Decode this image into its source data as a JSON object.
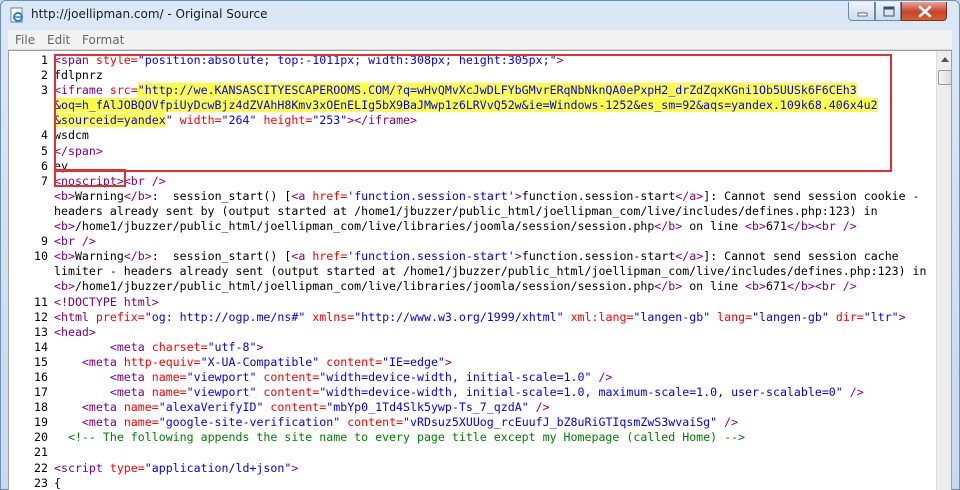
{
  "window": {
    "title": "http://joellipman.com/ - Original Source"
  },
  "menu": [
    "File",
    "Edit",
    "Format"
  ],
  "colors": {
    "tag": "#800080",
    "attr": "#ff0000",
    "value": "#0000ff",
    "comment": "#008000",
    "highlight": "#ffff44",
    "annotation": "#e03030"
  },
  "source": {
    "lines": [
      {
        "n": "1",
        "tokens": [
          [
            "tag",
            "<span "
          ],
          [
            "att",
            "style="
          ],
          [
            "val",
            "\"position:absolute; top:-1011px; width:308px; height:305px;\""
          ],
          [
            "tag",
            ">"
          ]
        ]
      },
      {
        "n": "2",
        "tokens": [
          [
            "plain",
            "fdlpnrz"
          ]
        ]
      },
      {
        "n": "3",
        "tokens": [
          [
            "tag",
            "<iframe "
          ],
          [
            "att",
            "src="
          ],
          [
            "valhl",
            "\"http://we.KANSASCITYESCAPEROOMS.COM/?q=wHvQMvXcJwDLFYbGMvrERqNbNknQA0ePxpH2_drZdZqxKGni1Ob5UUSk6F6CEh3"
          ]
        ]
      },
      {
        "n": "",
        "tokens": [
          [
            "valhl",
            "&oq=h_fAlJOBQOVfpiUyDcwBjz4dZVAhH8Kmv3xOEnELIg5bX9BaJMwp1z6LRVvQ52w&ie=Windows-1252&es_sm=92&aqs=yandex.109k68.406x4u2"
          ]
        ]
      },
      {
        "n": "",
        "tokens": [
          [
            "valhl",
            "&sourceid=yandex"
          ],
          [
            "val",
            "\" "
          ],
          [
            "att",
            "width="
          ],
          [
            "val",
            "\"264\" "
          ],
          [
            "att",
            "height="
          ],
          [
            "val",
            "\"253\""
          ],
          [
            "tag",
            "></iframe>"
          ]
        ]
      },
      {
        "n": "4",
        "tokens": [
          [
            "plain",
            "wsdcm"
          ]
        ]
      },
      {
        "n": "5",
        "tokens": [
          [
            "tag",
            "</span>"
          ]
        ]
      },
      {
        "n": "6",
        "tokens": [
          [
            "plain",
            "ey"
          ]
        ]
      },
      {
        "n": "7",
        "tokens": [
          [
            "tag",
            "<noscript>"
          ],
          [
            "tag",
            "<br />"
          ]
        ]
      },
      {
        "n": "",
        "tokens": [
          [
            "tag",
            "<b>"
          ],
          [
            "plain",
            "Warning"
          ],
          [
            "tag",
            "</b>"
          ],
          [
            "plain",
            ":  session_start() ["
          ],
          [
            "tag",
            "<a "
          ],
          [
            "att",
            "href="
          ],
          [
            "val",
            "'function.session-start'"
          ],
          [
            "tag",
            ">"
          ],
          [
            "plain",
            "function.session-start"
          ],
          [
            "tag",
            "</a>"
          ],
          [
            "plain",
            "]: Cannot send session cookie -"
          ]
        ]
      },
      {
        "n": "",
        "tokens": [
          [
            "plain",
            "headers already sent by (output started at /home1/jbuzzer/public_html/joellipman_com/live/includes/defines.php:123) in"
          ]
        ]
      },
      {
        "n": "",
        "tokens": [
          [
            "tag",
            "<b>"
          ],
          [
            "plain",
            "/home1/jbuzzer/public_html/joellipman_com/live/libraries/joomla/session/session.php"
          ],
          [
            "tag",
            "</b>"
          ],
          [
            "plain",
            " on line "
          ],
          [
            "tag",
            "<b>"
          ],
          [
            "plain",
            "671"
          ],
          [
            "tag",
            "</b><br />"
          ]
        ]
      },
      {
        "n": "9",
        "tokens": [
          [
            "tag",
            "<br />"
          ]
        ]
      },
      {
        "n": "10",
        "tokens": [
          [
            "tag",
            "<b>"
          ],
          [
            "plain",
            "Warning"
          ],
          [
            "tag",
            "</b>"
          ],
          [
            "plain",
            ":  session_start() ["
          ],
          [
            "tag",
            "<a "
          ],
          [
            "att",
            "href="
          ],
          [
            "val",
            "'function.session-start'"
          ],
          [
            "tag",
            ">"
          ],
          [
            "plain",
            "function.session-start"
          ],
          [
            "tag",
            "</a>"
          ],
          [
            "plain",
            "]: Cannot send session cache"
          ]
        ]
      },
      {
        "n": "",
        "tokens": [
          [
            "plain",
            "limiter - headers already sent (output started at /home1/jbuzzer/public_html/joellipman_com/live/includes/defines.php:123) in"
          ]
        ]
      },
      {
        "n": "",
        "tokens": [
          [
            "tag",
            "<b>"
          ],
          [
            "plain",
            "/home1/jbuzzer/public_html/joellipman_com/live/libraries/joomla/session/session.php"
          ],
          [
            "tag",
            "</b>"
          ],
          [
            "plain",
            " on line "
          ],
          [
            "tag",
            "<b>"
          ],
          [
            "plain",
            "671"
          ],
          [
            "tag",
            "</b><br />"
          ]
        ]
      },
      {
        "n": "11",
        "tokens": [
          [
            "tag",
            "<!DOCTYPE html>"
          ]
        ]
      },
      {
        "n": "12",
        "tokens": [
          [
            "tag",
            "<html "
          ],
          [
            "att",
            "prefix="
          ],
          [
            "val",
            "\"og: http://ogp.me/ns#\" "
          ],
          [
            "att",
            "xmlns="
          ],
          [
            "val",
            "\"http://www.w3.org/1999/xhtml\" "
          ],
          [
            "att",
            "xml:lang="
          ],
          [
            "val",
            "\"langen-gb\" "
          ],
          [
            "att",
            "lang="
          ],
          [
            "val",
            "\"langen-gb\" "
          ],
          [
            "att",
            "dir="
          ],
          [
            "val",
            "\"ltr\""
          ],
          [
            "tag",
            ">"
          ]
        ]
      },
      {
        "n": "13",
        "tokens": [
          [
            "tag",
            "<head>"
          ]
        ]
      },
      {
        "n": "14",
        "tokens": [
          [
            "plain",
            "        "
          ],
          [
            "tag",
            "<meta "
          ],
          [
            "att",
            "charset="
          ],
          [
            "val",
            "\"utf-8\""
          ],
          [
            "tag",
            ">"
          ]
        ]
      },
      {
        "n": "15",
        "tokens": [
          [
            "plain",
            "    "
          ],
          [
            "tag",
            "<meta "
          ],
          [
            "att",
            "http-equiv="
          ],
          [
            "val",
            "\"X-UA-Compatible\" "
          ],
          [
            "att",
            "content="
          ],
          [
            "val",
            "\"IE=edge\""
          ],
          [
            "tag",
            ">"
          ]
        ]
      },
      {
        "n": "16",
        "tokens": [
          [
            "plain",
            "        "
          ],
          [
            "tag",
            "<meta "
          ],
          [
            "att",
            "name="
          ],
          [
            "val",
            "\"viewport\" "
          ],
          [
            "att",
            "content="
          ],
          [
            "val",
            "\"width=device-width, initial-scale=1.0\" "
          ],
          [
            "tag",
            "/>"
          ]
        ]
      },
      {
        "n": "17",
        "tokens": [
          [
            "plain",
            "        "
          ],
          [
            "tag",
            "<meta "
          ],
          [
            "att",
            "name="
          ],
          [
            "val",
            "\"viewport\" "
          ],
          [
            "att",
            "content="
          ],
          [
            "val",
            "\"width=device-width, initial-scale=1.0, maximum-scale=1.0, user-scalable=0\" "
          ],
          [
            "tag",
            "/>"
          ]
        ]
      },
      {
        "n": "18",
        "tokens": [
          [
            "plain",
            "    "
          ],
          [
            "tag",
            "<meta "
          ],
          [
            "att",
            "name="
          ],
          [
            "val",
            "\"alexaVerifyID\" "
          ],
          [
            "att",
            "content="
          ],
          [
            "val",
            "\"mbYp0_1Td4Slk5ywp-Ts_7_qzdA\" "
          ],
          [
            "tag",
            "/>"
          ]
        ]
      },
      {
        "n": "19",
        "tokens": [
          [
            "plain",
            "    "
          ],
          [
            "tag",
            "<meta "
          ],
          [
            "att",
            "name="
          ],
          [
            "val",
            "\"google-site-verification\" "
          ],
          [
            "att",
            "content="
          ],
          [
            "val",
            "\"vRDsuz5XUUog_rcEuufJ_bZ8uRiGTIqsmZwS3wvaiSg\" "
          ],
          [
            "tag",
            "/>"
          ]
        ]
      },
      {
        "n": "20",
        "tokens": [
          [
            "plain",
            "  "
          ],
          [
            "cmt",
            "<!-- The following appends the site name to every page title except my Homepage (called Home) -->"
          ]
        ]
      },
      {
        "n": "21",
        "tokens": []
      },
      {
        "n": "22",
        "tokens": [
          [
            "tag",
            "<script "
          ],
          [
            "att",
            "type="
          ],
          [
            "val",
            "\"application/ld+json\""
          ],
          [
            "tag",
            ">"
          ]
        ]
      },
      {
        "n": "23",
        "tokens": [
          [
            "plain",
            "{"
          ]
        ]
      }
    ]
  }
}
